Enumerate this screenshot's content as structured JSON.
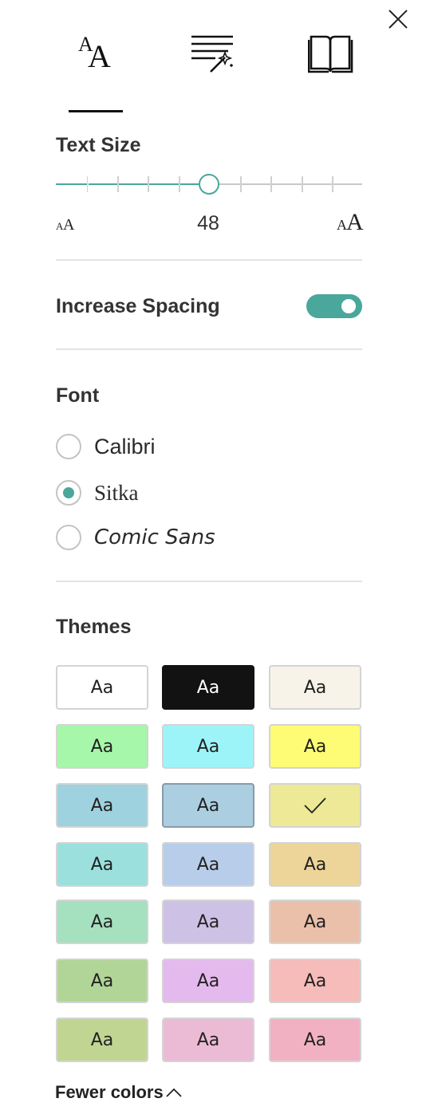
{
  "header": {
    "close_icon": "close-icon",
    "tabs": [
      {
        "id": "text-options",
        "icon": "text-size-icon",
        "active": true
      },
      {
        "id": "grammar-options",
        "icon": "grammar-magic-icon",
        "active": false
      },
      {
        "id": "reading-preferences",
        "icon": "book-icon",
        "active": false
      }
    ]
  },
  "text_size": {
    "title": "Text Size",
    "value": "48",
    "small_icon": "text-smaller-icon",
    "large_icon": "text-larger-icon",
    "accent": "#4aa79b"
  },
  "spacing": {
    "label": "Increase Spacing",
    "on": true
  },
  "font": {
    "title": "Font",
    "options": [
      {
        "label": "Calibri",
        "selected": false
      },
      {
        "label": "Sitka",
        "selected": true
      },
      {
        "label": "Comic Sans",
        "selected": false
      }
    ]
  },
  "themes": {
    "title": "Themes",
    "sample": "Aa",
    "selected_icon": "checkmark-icon",
    "swatches": [
      {
        "bg": "#ffffff",
        "fg": "#222222"
      },
      {
        "bg": "#121212",
        "fg": "#ffffff"
      },
      {
        "bg": "#f7f3e8",
        "fg": "#222222"
      },
      {
        "bg": "#a6f7a9",
        "fg": "#222222"
      },
      {
        "bg": "#9df4f8",
        "fg": "#222222"
      },
      {
        "bg": "#fdfc74",
        "fg": "#222222"
      },
      {
        "bg": "#9dd2de",
        "fg": "#222222"
      },
      {
        "bg": "#abcfe1",
        "fg": "#222222"
      },
      {
        "bg": "#ede996",
        "fg": "#222222",
        "selected": true
      },
      {
        "bg": "#9be0dd",
        "fg": "#222222"
      },
      {
        "bg": "#b7cdea",
        "fg": "#222222"
      },
      {
        "bg": "#edd599",
        "fg": "#222222"
      },
      {
        "bg": "#a5e0bf",
        "fg": "#222222"
      },
      {
        "bg": "#cdc1e5",
        "fg": "#222222"
      },
      {
        "bg": "#eac0aa",
        "fg": "#222222"
      },
      {
        "bg": "#b1d596",
        "fg": "#222222"
      },
      {
        "bg": "#e4b9ed",
        "fg": "#222222"
      },
      {
        "bg": "#f5bcba",
        "fg": "#222222"
      },
      {
        "bg": "#c1d592",
        "fg": "#222222"
      },
      {
        "bg": "#ebbbd5",
        "fg": "#222222"
      },
      {
        "bg": "#f2b1c2",
        "fg": "#222222"
      }
    ],
    "fewer_label": "Fewer colors",
    "fewer_icon": "chevron-up-icon"
  }
}
